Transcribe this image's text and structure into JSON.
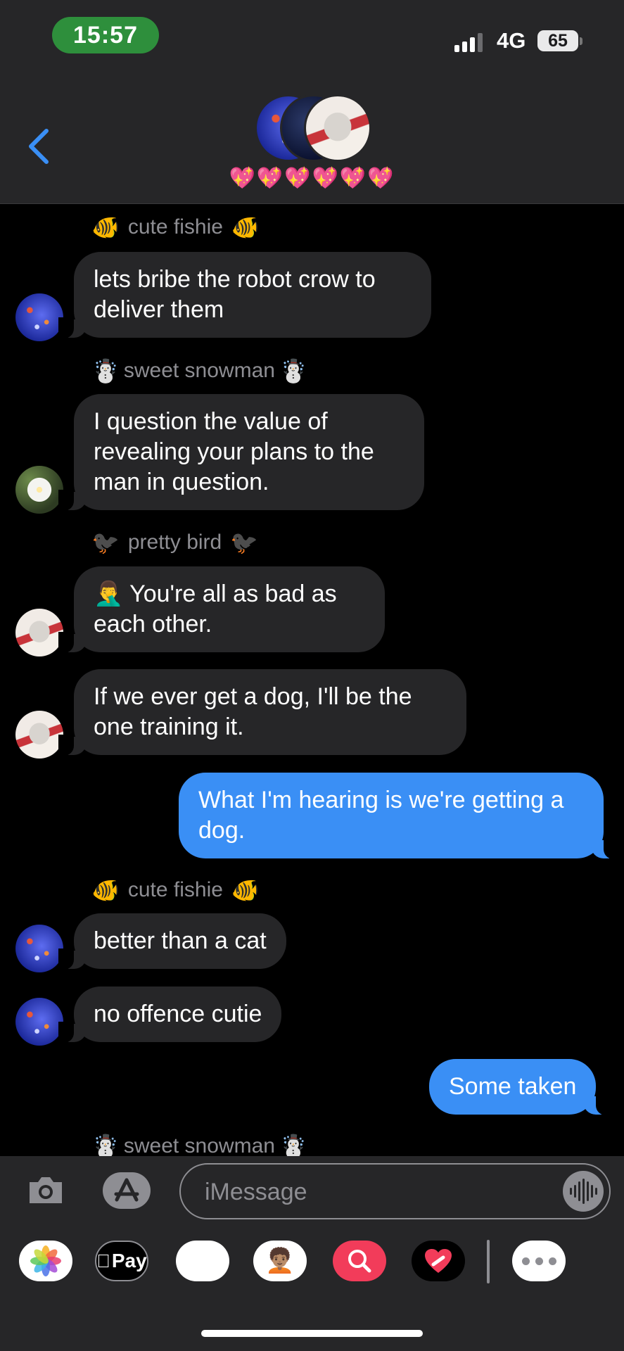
{
  "status_bar": {
    "time": "15:57",
    "network": "4G",
    "battery": "65"
  },
  "conversation": {
    "group_name": "💖💖💖💖💖💖"
  },
  "messages": [
    {
      "sender": "cute fishie",
      "sender_emoji": "🐠",
      "text": "lets bribe the robot crow to deliver them"
    },
    {
      "sender": "sweet snowman",
      "sender_emoji": "☃️",
      "text": "I question the value of revealing your plans to the man in question."
    },
    {
      "sender": "pretty bird",
      "sender_emoji": "🐦‍⬛",
      "text": "🤦‍♂️ You're all as bad as each other."
    },
    {
      "text": "If we ever get a dog, I'll be the one training it."
    },
    {
      "text": "What I'm hearing is we're getting a dog."
    },
    {
      "sender": "cute fishie",
      "sender_emoji": "🐠",
      "text": "better than a cat"
    },
    {
      "text": "no offence cutie"
    },
    {
      "text": "Some taken"
    },
    {
      "sender": "sweet snowman",
      "sender_emoji": "☃️"
    }
  ],
  "input": {
    "placeholder": "iMessage"
  },
  "app_drawer": {
    "apple_pay_label": "Pay",
    "memoji_1": "🐵",
    "memoji_2": "🧑🏽‍🦱"
  },
  "colors": {
    "outgoing_bubble": "#3a8ff5",
    "incoming_bubble": "#262628",
    "accent": "#2e8f3c"
  },
  "icons": [
    "back-chevron-icon",
    "camera-icon",
    "app-store-icon",
    "dictation-icon",
    "photos-icon",
    "apple-pay-icon",
    "memoji-icon",
    "search-icon",
    "fitness-icon",
    "more-icon"
  ]
}
